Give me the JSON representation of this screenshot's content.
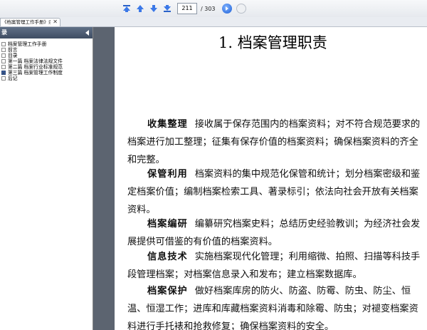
{
  "toolbar": {
    "current_page": "211",
    "total_pages": "/ 303"
  },
  "tab": {
    "title": "《档案管理工作手册》余述...",
    "close": "✕"
  },
  "sidebar": {
    "title": "录",
    "items": [
      {
        "label": "档案管理工作手册"
      },
      {
        "label": "前言"
      },
      {
        "label": "目录"
      },
      {
        "label": "第一篇  档案法律法规文件"
      },
      {
        "label": "第二篇  档案行业标准规范"
      },
      {
        "label": "第三篇  档案管理工作制度"
      },
      {
        "label": "后记"
      }
    ]
  },
  "document": {
    "title": "1. 档案管理职责",
    "sections": [
      {
        "term": "收集整理",
        "text": "接收属于保存范围内的档案资料；对不符合规范要求的档案进行加工整理；征集有保存价值的档案资料；确保档案资料的齐全和完整。"
      },
      {
        "term": "保管利用",
        "text": "档案资料的集中规范化保管和统计；划分档案密级和鉴定档案价值；编制档案检索工具、著录标引；依法向社会开放有关档案资料。"
      },
      {
        "term": "档案编研",
        "text": "编纂研究档案史料；总结历史经验教训；为经济社会发展提供可借鉴的有价值的档案资料。"
      },
      {
        "term": "信息技术",
        "text": "实施档案现代化管理；利用缩微、拍照、扫描等科技手段管理档案；对档案信息录入和发布；建立档案数据库。"
      },
      {
        "term": "档案保护",
        "text": "做好档案库房的防火、防盗、防霉、防虫、防尘、恒温、恒湿工作；进库和库藏档案资料消毒和除霉、防虫；对褪变档案资料进行手托裱和抢救修复；确保档案资料的安全。"
      }
    ]
  },
  "colors": {
    "sidebar_header": "#4a5a72",
    "gutter": "#5c6470",
    "go_button": "#1d5fd6"
  }
}
